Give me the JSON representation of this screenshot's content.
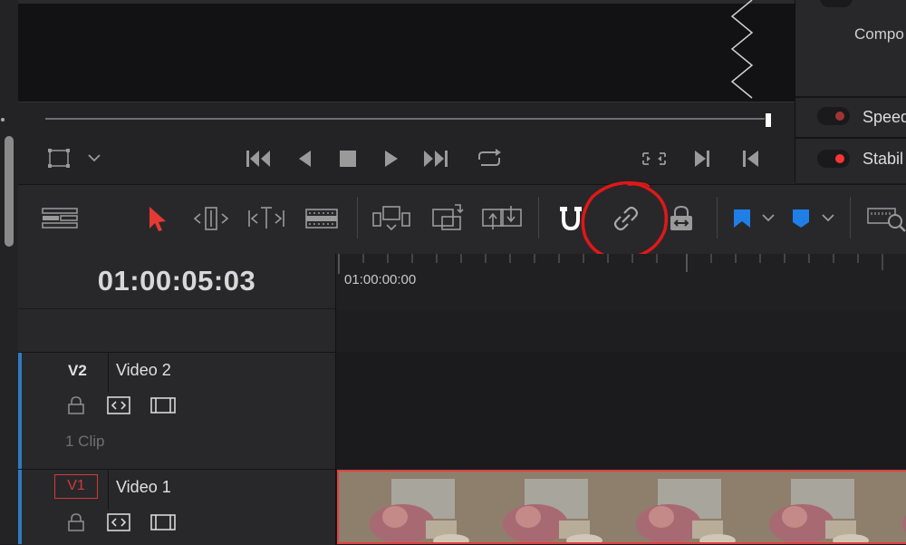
{
  "inspector": {
    "composite_label": "Compo",
    "speed_label": "Speed",
    "stabil_label": "Stabil",
    "speed_dot_color": "#a03434",
    "stabil_dot_color": "#ff3333"
  },
  "toolbar": {
    "tools": [
      "timeline-view-options-icon",
      "selection-tool-icon",
      "trim-edit-icon",
      "dynamic-trim-icon",
      "blade-tool-icon",
      "insert-clip-icon",
      "overwrite-clip-icon",
      "replace-clip-icon",
      "snapping-icon",
      "linked-selection-icon",
      "position-lock-icon",
      "flag-icon",
      "marker-icon",
      "zoom-icon"
    ],
    "annotation_color": "#e01818"
  },
  "timeline": {
    "timecode": "01:00:05:03",
    "ruler_start": "01:00:00:00"
  },
  "tracks": [
    {
      "id": "V2",
      "name": "Video 2",
      "clip_count": "1 Clip"
    },
    {
      "id": "V1",
      "name": "Video 1"
    }
  ],
  "accent_colors": {
    "track_accent": "#2f7bbf",
    "selection_red": "#e04040",
    "flag_blue": "#1f7fe6"
  }
}
